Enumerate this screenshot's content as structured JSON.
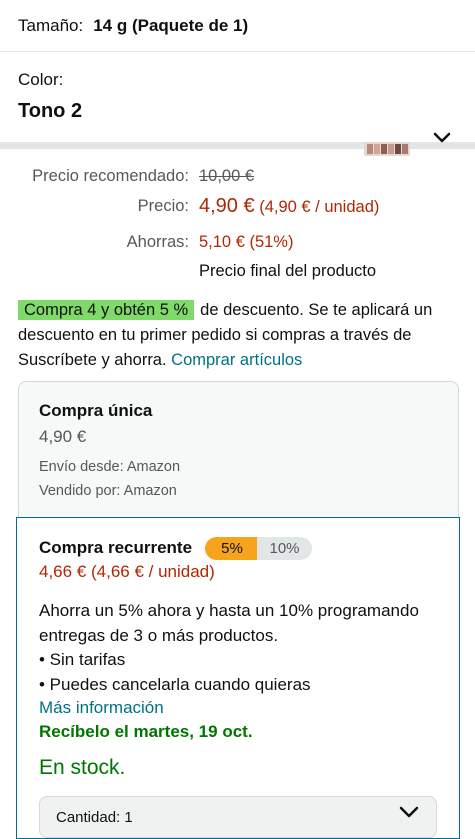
{
  "size": {
    "label": "Tamaño:",
    "value": "14 g (Paquete de 1)"
  },
  "color": {
    "label": "Color:",
    "value": "Tono 2"
  },
  "prices": {
    "list_label": "Precio recomendado:",
    "list_value": "10,00 €",
    "price_label": "Precio:",
    "price_value": "4,90 €",
    "price_unit": "(4,90 € / unidad)",
    "savings_label": "Ahorras:",
    "savings_value": "5,10 € (51%)",
    "final_note": "Precio final del producto"
  },
  "promo": {
    "badge": "Compra 4 y obtén 5 %",
    "text": "de descuento. Se te aplicará un descuento en tu primer pedido si compras a través de Suscríbete y ahorra.",
    "link": "Comprar artículos"
  },
  "one_time": {
    "title": "Compra única",
    "price": "4,90 €",
    "ship_from": "Envío desde: Amazon",
    "sold_by": "Vendido por: Amazon"
  },
  "subscribe": {
    "title": "Compra recurrente",
    "chip_selected": "5%",
    "chip_other": "10%",
    "price": "4,66 € (4,66 € / unidad)",
    "desc1": "Ahorra un 5% ahora y hasta un 10% programando entregas de 3 o más productos.",
    "bullet1": "• Sin tarifas",
    "bullet2": "• Puedes cancelarla cuando quieras",
    "more": "Más información",
    "delivery": "Recíbelo el martes, 19 oct.",
    "stock": "En stock.",
    "quantity": "Cantidad:  1"
  },
  "colors": {
    "price_red": "#B12704",
    "link_teal": "#007185",
    "badge_green": "#7FDA69",
    "chip_orange": "#F7A41D",
    "stock_green": "#007600"
  },
  "icons": [
    "chevron-down-icon",
    "palette-swatch-icon"
  ]
}
